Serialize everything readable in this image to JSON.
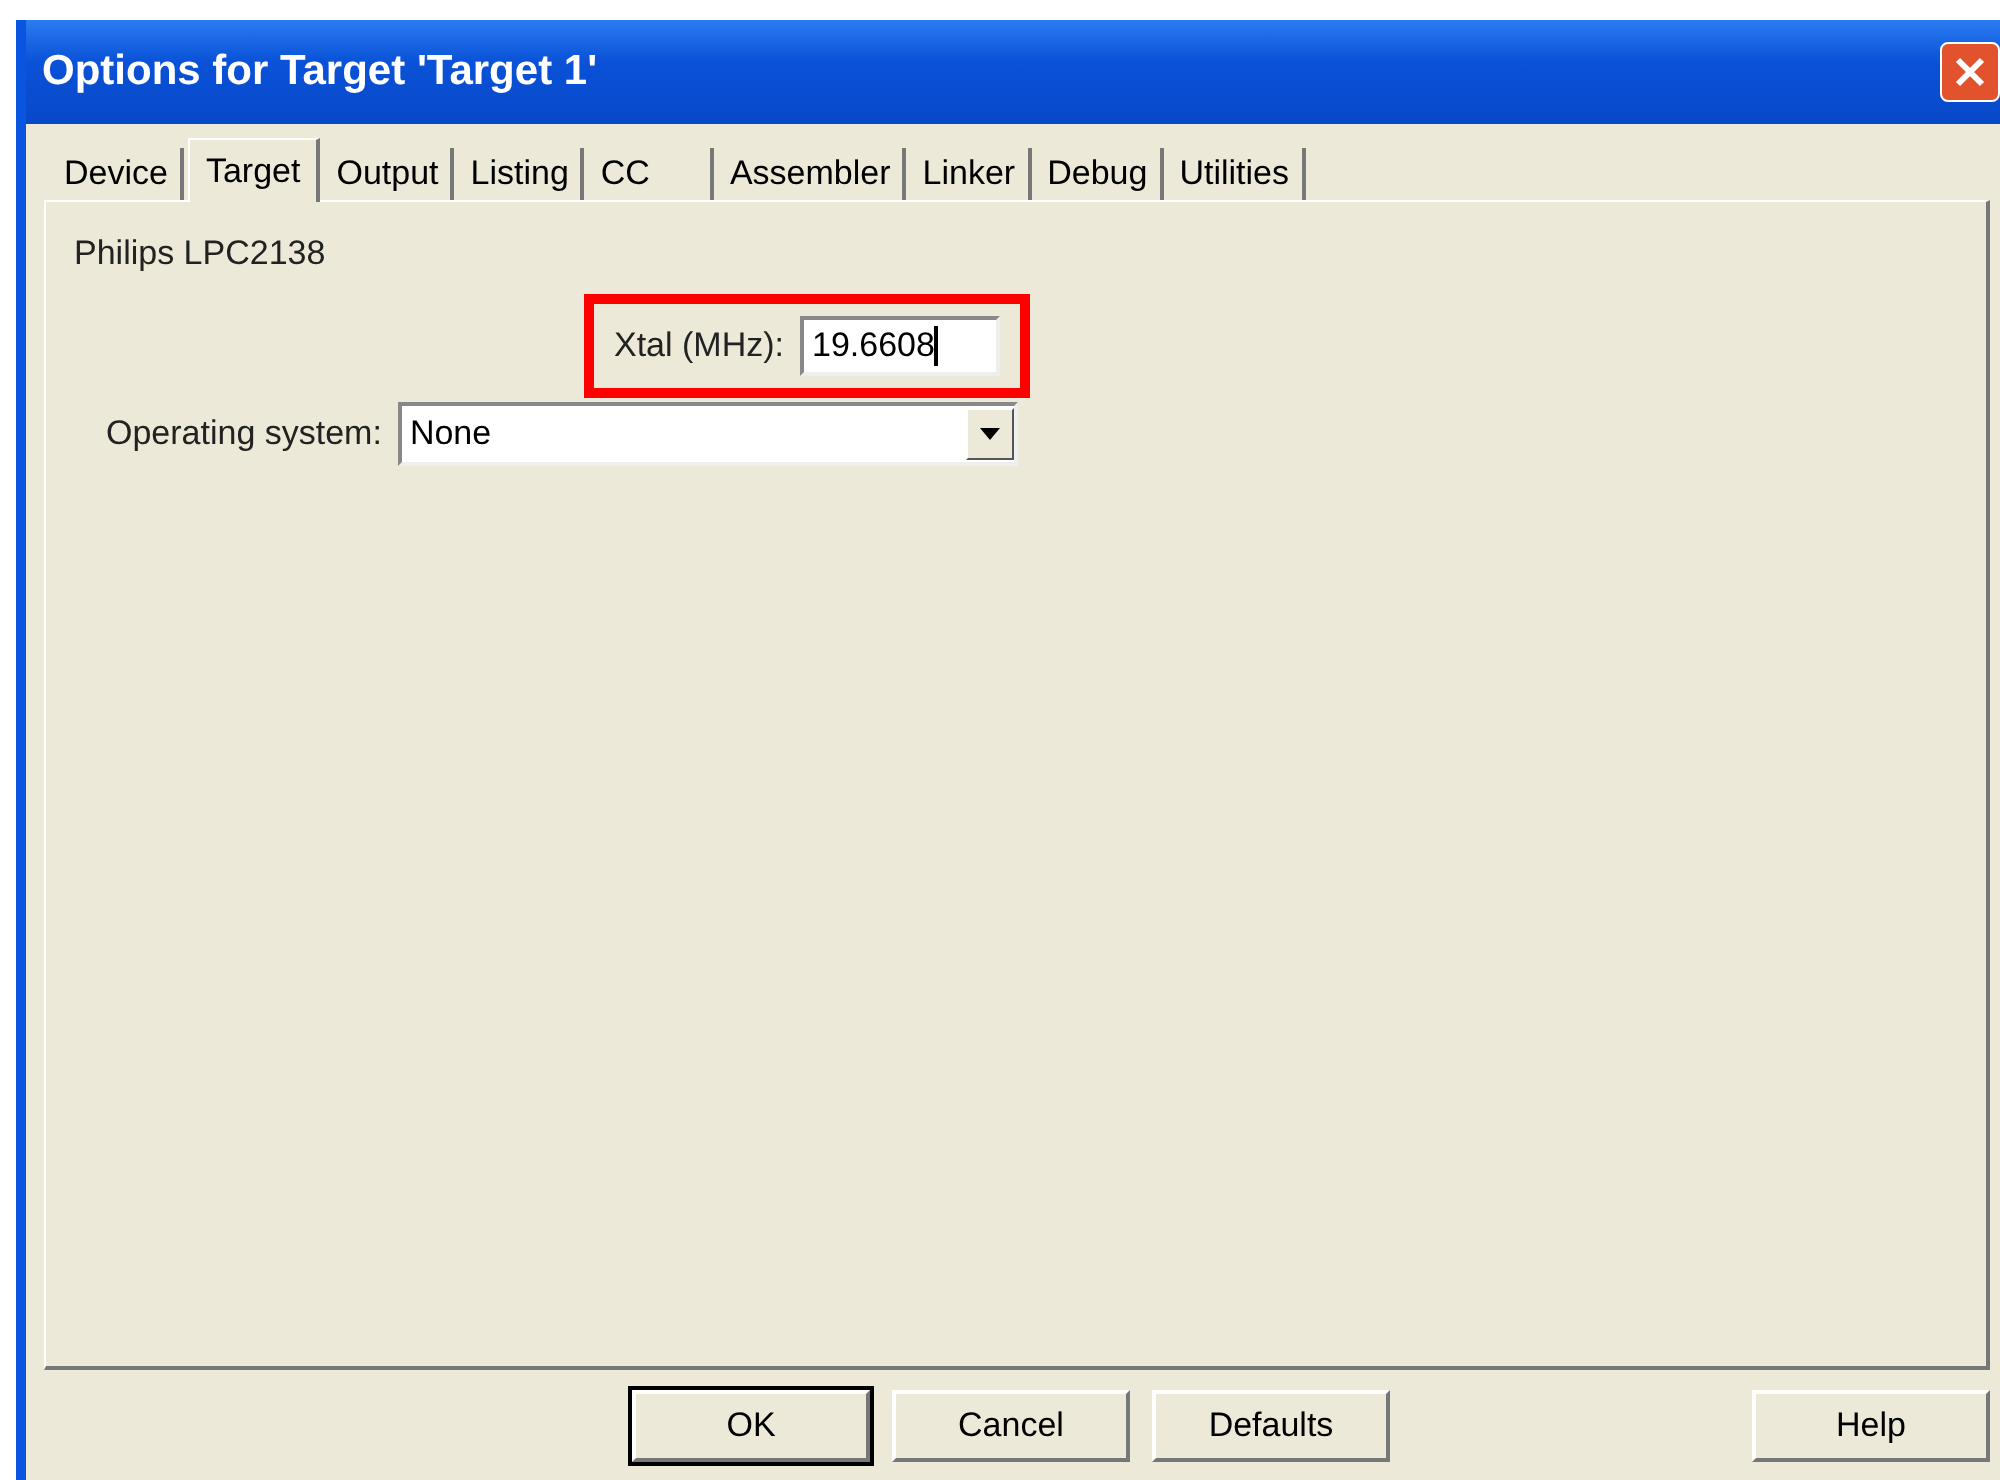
{
  "window": {
    "title": "Options for Target 'Target 1'"
  },
  "tabs": [
    {
      "label": "Device",
      "selected": false
    },
    {
      "label": "Target",
      "selected": true
    },
    {
      "label": "Output",
      "selected": false
    },
    {
      "label": "Listing",
      "selected": false
    },
    {
      "label": "CC",
      "selected": false
    },
    {
      "label": "Assembler",
      "selected": false
    },
    {
      "label": "Linker",
      "selected": false
    },
    {
      "label": "Debug",
      "selected": false
    },
    {
      "label": "Utilities",
      "selected": false
    }
  ],
  "device": "Philips LPC2138",
  "xtal": {
    "label": "Xtal (MHz):",
    "value": "19.6608",
    "highlighted": true
  },
  "operating_system": {
    "label": "Operating system:",
    "value": "None"
  },
  "buttons": [
    {
      "label": "OK",
      "default": true
    },
    {
      "label": "Cancel",
      "default": false
    },
    {
      "label": "Defaults",
      "default": false
    },
    {
      "label": "Help",
      "default": false
    }
  ]
}
